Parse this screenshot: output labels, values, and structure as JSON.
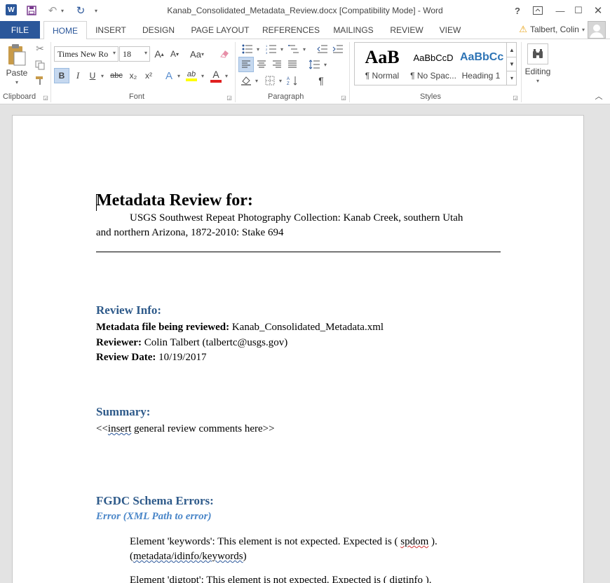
{
  "titlebar": {
    "title": "Kanab_Consolidated_Metadata_Review.docx [Compatibility Mode] - Word",
    "word_icon": "W",
    "help": "?",
    "minimize": "—",
    "maximize": "☐",
    "close": "✕"
  },
  "tabs": {
    "file": "FILE",
    "items": [
      "HOME",
      "INSERT",
      "DESIGN",
      "PAGE LAYOUT",
      "REFERENCES",
      "MAILINGS",
      "REVIEW",
      "VIEW"
    ],
    "active": "HOME"
  },
  "user": {
    "name": "Talbert, Colin"
  },
  "ribbon": {
    "clipboard": {
      "label": "Clipboard",
      "paste": "Paste"
    },
    "font": {
      "label": "Font",
      "font_name": "Times New Ro",
      "font_size": "18",
      "bold": "B",
      "italic": "I",
      "underline": "U",
      "strike": "abc",
      "subscript": "x₂",
      "superscript": "x²",
      "grow": "A",
      "shrink": "A",
      "case": "Aa",
      "text_effects": "A",
      "highlight": "ab",
      "font_color": "A"
    },
    "paragraph": {
      "label": "Paragraph"
    },
    "styles": {
      "label": "Styles",
      "items": [
        {
          "sample": "AaB",
          "name": "¶ Normal"
        },
        {
          "sample": "AaBbCcD",
          "name": "¶ No Spac..."
        },
        {
          "sample": "AaBbCc",
          "name": "Heading 1"
        }
      ]
    },
    "editing": {
      "label": "Editing"
    }
  },
  "colors": {
    "accent": "#2b579a",
    "heading": "#2e5a8a",
    "subheading": "#4a86c8",
    "highlight_yellow": "#ffff00",
    "font_red": "#e02020"
  },
  "document": {
    "title": "Metadata Review for:",
    "collection_line1": "USGS Southwest Repeat Photography Collection: Kanab Creek, southern Utah",
    "collection_line2": "and northern Arizona, 1872-2010: Stake 694",
    "review_info_heading": "Review Info:",
    "file_label": "Metadata file being reviewed:",
    "file_value": " Kanab_Consolidated_Metadata.xml",
    "reviewer_label": "Reviewer:",
    "reviewer_value": " Colin Talbert (talbertc@usgs.gov)",
    "date_label": "Review Date:",
    "date_value": " 10/19/2017",
    "summary_heading": "Summary:",
    "summary_pre": "<<",
    "summary_squig": "insert",
    "summary_post": " general review comments here>>",
    "schema_heading": "FGDC Schema Errors:",
    "schema_sub": "Error (XML Path to error)",
    "err1_pre": "Element 'keywords': This element is not expected. Expected is ( ",
    "err1_squig": "spdom",
    "err1_post": " ).",
    "err1_path_pre": "(",
    "err1_path": "metadata/idinfo/keywords",
    "err1_path_post": ")",
    "err2_pre": "Element 'digtopt': This element is not expected. Expected is ( ",
    "err2_squig": "digtinfo",
    "err2_post": " )."
  }
}
